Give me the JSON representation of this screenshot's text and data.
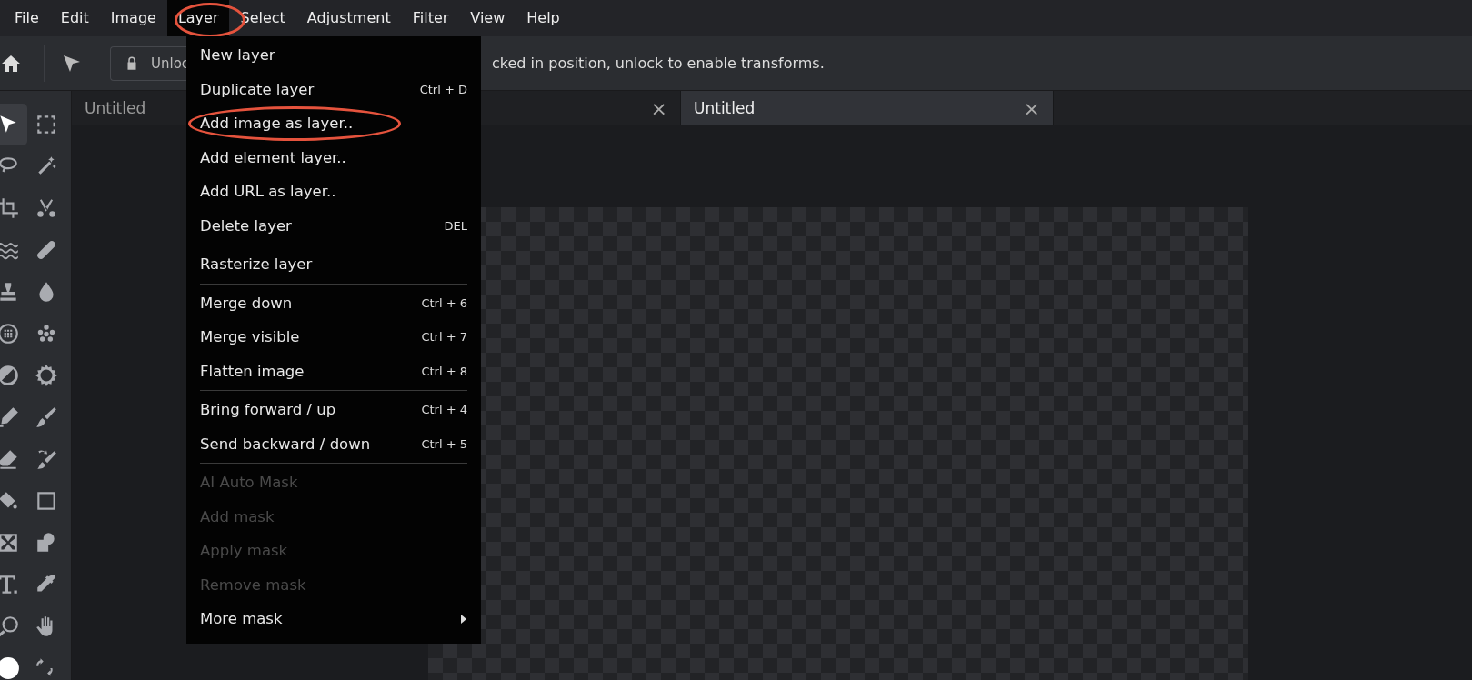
{
  "menubar": [
    {
      "label": "File",
      "selected": false,
      "circled": false
    },
    {
      "label": "Edit",
      "selected": false,
      "circled": false
    },
    {
      "label": "Image",
      "selected": false,
      "circled": false
    },
    {
      "label": "Layer",
      "selected": true,
      "circled": true
    },
    {
      "label": "Select",
      "selected": false,
      "circled": false
    },
    {
      "label": "Adjustment",
      "selected": false,
      "circled": false
    },
    {
      "label": "Filter",
      "selected": false,
      "circled": false
    },
    {
      "label": "View",
      "selected": false,
      "circled": false
    },
    {
      "label": "Help",
      "selected": false,
      "circled": false
    }
  ],
  "toolbar": {
    "unlock_button": "Unloc",
    "status": "cked in position, unlock to enable transforms."
  },
  "tools": [
    {
      "selected": true
    },
    {
      "selected": false
    },
    {
      "selected": false
    },
    {
      "selected": false
    },
    {
      "selected": false
    },
    {
      "selected": false
    },
    {
      "selected": false
    },
    {
      "selected": false
    },
    {
      "selected": false
    },
    {
      "selected": false
    },
    {
      "selected": false
    },
    {
      "selected": false
    },
    {
      "selected": false
    },
    {
      "selected": false
    },
    {
      "selected": false
    },
    {
      "selected": false
    },
    {
      "selected": false
    },
    {
      "selected": false
    },
    {
      "selected": false
    },
    {
      "selected": false
    },
    {
      "selected": false
    },
    {
      "selected": false
    },
    {
      "selected": false
    },
    {
      "selected": false
    },
    {
      "selected": false
    },
    {
      "selected": false
    },
    {
      "selected": false
    },
    {
      "selected": false
    }
  ],
  "tabs": [
    {
      "label": "Untitled",
      "selected": false,
      "closable": false
    },
    {
      "selected": false,
      "closable": true
    },
    {
      "label": "Untitled",
      "selected": true,
      "closable": true
    }
  ],
  "tab_close": "×",
  "layer_menu": [
    {
      "label": "New layer",
      "disabled": false,
      "separator_before": false,
      "circled": false,
      "submenu": false
    },
    {
      "label": "Duplicate layer",
      "shortcut": "Ctrl + D",
      "disabled": false,
      "separator_before": false,
      "circled": false,
      "submenu": false
    },
    {
      "label": "Add image as layer..",
      "disabled": false,
      "separator_before": false,
      "circled": true,
      "submenu": false
    },
    {
      "label": "Add element layer..",
      "disabled": false,
      "separator_before": false,
      "circled": false,
      "submenu": false
    },
    {
      "label": "Add URL as layer..",
      "disabled": false,
      "separator_before": false,
      "circled": false,
      "submenu": false
    },
    {
      "label": "Delete layer",
      "shortcut": "DEL",
      "disabled": false,
      "separator_before": false,
      "circled": false,
      "submenu": false
    },
    {
      "label": "Rasterize layer",
      "disabled": false,
      "separator_before": true,
      "circled": false,
      "submenu": false
    },
    {
      "label": "Merge down",
      "shortcut": "Ctrl + 6",
      "disabled": false,
      "separator_before": true,
      "circled": false,
      "submenu": false
    },
    {
      "label": "Merge visible",
      "shortcut": "Ctrl + 7",
      "disabled": false,
      "separator_before": false,
      "circled": false,
      "submenu": false
    },
    {
      "label": "Flatten image",
      "shortcut": "Ctrl + 8",
      "disabled": false,
      "separator_before": false,
      "circled": false,
      "submenu": false
    },
    {
      "label": "Bring forward / up",
      "shortcut": "Ctrl + 4",
      "disabled": false,
      "separator_before": true,
      "circled": false,
      "submenu": false
    },
    {
      "label": "Send backward / down",
      "shortcut": "Ctrl + 5",
      "disabled": false,
      "separator_before": false,
      "circled": false,
      "submenu": false
    },
    {
      "label": "AI Auto Mask",
      "disabled": true,
      "separator_before": true,
      "circled": false,
      "submenu": false
    },
    {
      "label": "Add mask",
      "disabled": true,
      "separator_before": false,
      "circled": false,
      "submenu": false
    },
    {
      "label": "Apply mask",
      "disabled": true,
      "separator_before": false,
      "circled": false,
      "submenu": false
    },
    {
      "label": "Remove mask",
      "disabled": true,
      "separator_before": false,
      "circled": false,
      "submenu": false
    },
    {
      "label": "More mask",
      "disabled": false,
      "separator_before": false,
      "circled": false,
      "submenu": true
    }
  ]
}
